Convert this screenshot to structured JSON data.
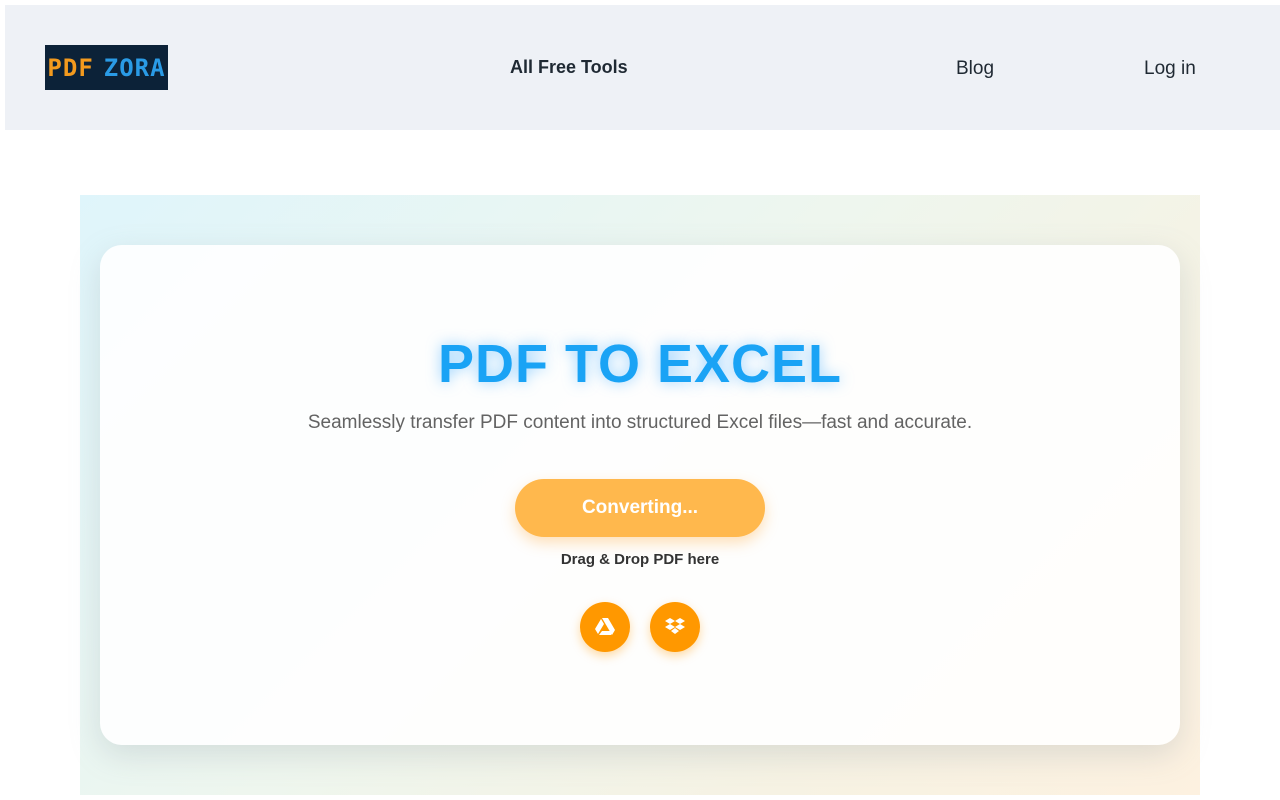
{
  "header": {
    "logo": {
      "part1": "PDF",
      "part2": "ZORA"
    },
    "nav": {
      "tools": "All Free Tools",
      "blog": "Blog",
      "login": "Log in"
    }
  },
  "hero": {
    "title": "PDF TO EXCEL",
    "subtitle": "Seamlessly transfer PDF content into structured Excel files—fast and accurate.",
    "convert_button": "Converting...",
    "drop_text": "Drag & Drop PDF here",
    "cloud_sources": [
      {
        "icon": "google-drive-icon"
      },
      {
        "icon": "dropbox-icon"
      }
    ]
  },
  "colors": {
    "accent_blue": "#1aa3f5",
    "orange": "#ff9800",
    "button_orange": "#ffb84d",
    "header_bg": "#eef1f6",
    "logo_bg": "#0c2238"
  }
}
